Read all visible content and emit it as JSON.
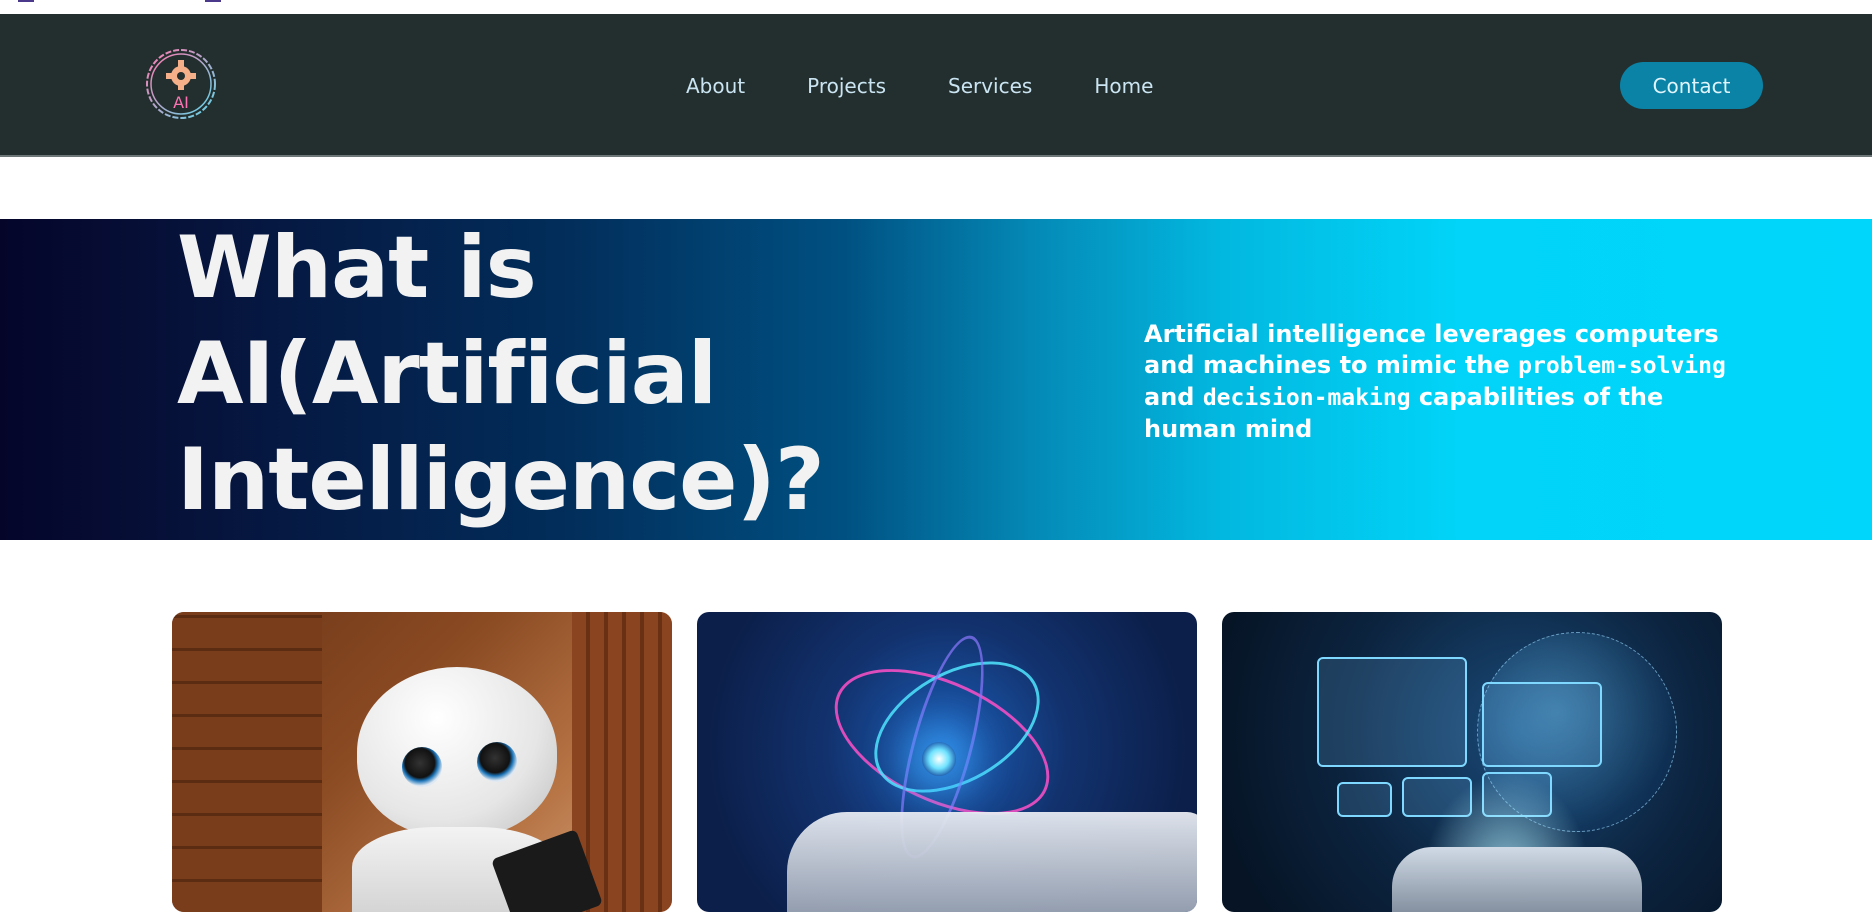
{
  "nav": {
    "links": [
      "About",
      "Projects",
      "Services",
      "Home"
    ],
    "contact_label": "Contact",
    "logo_text": "AI"
  },
  "hero": {
    "title": "What is AI(Artificial Intelligence)?",
    "desc_part1": "Artificial intelligence leverages computers and machines to mimic the ",
    "desc_code1": "problem-solving",
    "desc_and": " and ",
    "desc_code2": "decision-making",
    "desc_part2": " capabilities of the human mind"
  },
  "cards": [
    {
      "image": "robot-photo"
    },
    {
      "image": "robot-hand-atom"
    },
    {
      "image": "robot-hand-dashboard"
    }
  ],
  "colors": {
    "navbar_bg": "#222f2e",
    "contact_bg": "#0b83a6",
    "nav_link": "#cbe4f2"
  }
}
